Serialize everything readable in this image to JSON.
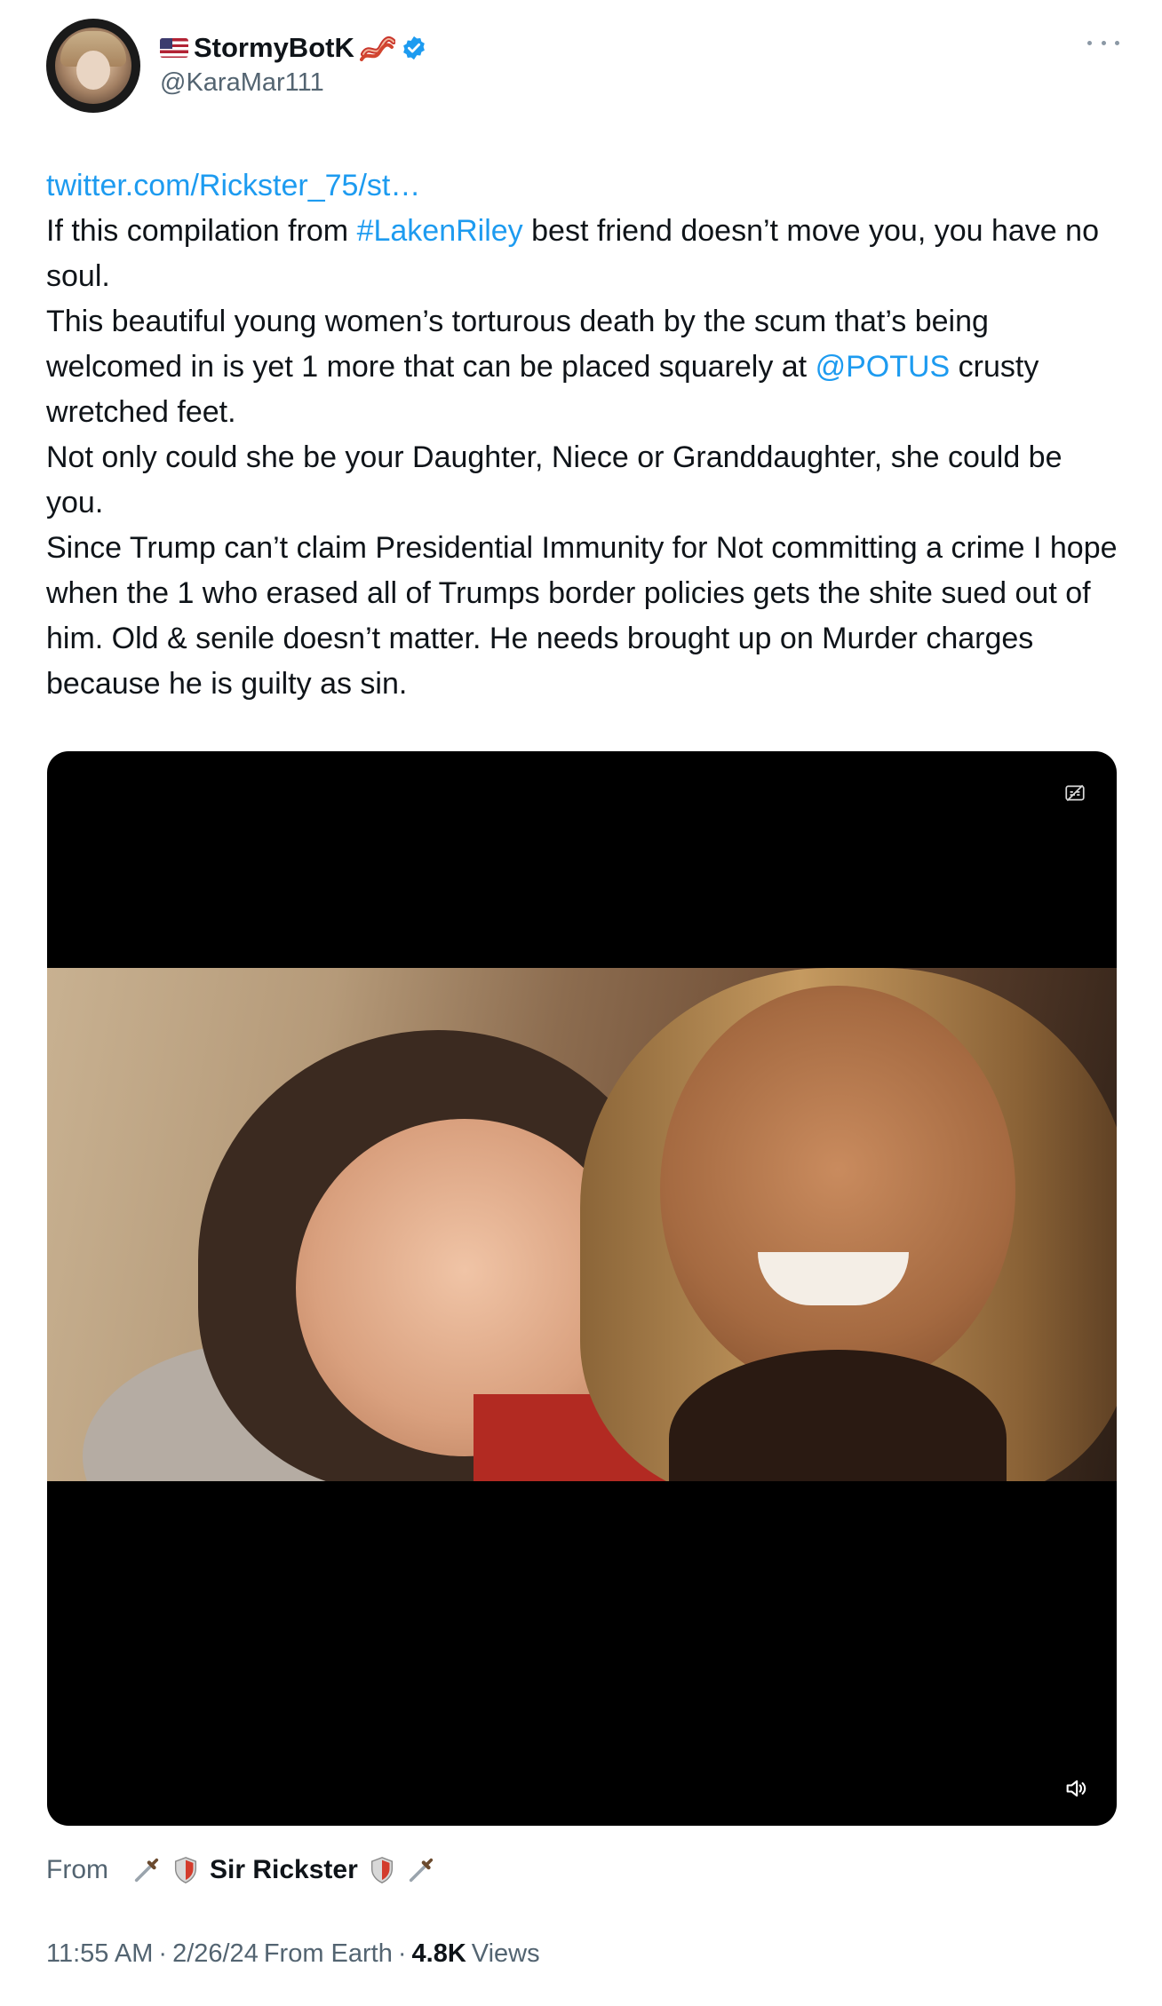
{
  "header": {
    "display_name": "StormyBotK",
    "handle": "@KaraMar111",
    "flag_icon": "us-flag-icon",
    "bacon_icon": "bacon-icon",
    "verified_icon": "verified-badge-icon",
    "verified_color": "#1d9bf0"
  },
  "tweet": {
    "link_text": "twitter.com/Rickster_75/st…",
    "line1_pre": "If this compilation from ",
    "hashtag": "#LakenRiley",
    "line1_post": " best friend doesn’t move you, you have no soul.",
    "line2_pre": "This beautiful young women’s torturous death by the scum that’s being welcomed in is yet 1 more that can be placed squarely at ",
    "mention": "@POTUS",
    "line2_post": " crusty wretched feet.",
    "line3": "Not only could she be your Daughter, Niece or Granddaughter, she could be you.",
    "line4": "Since Trump can’t claim Presidential Immunity for Not committing a crime I hope when the 1 who erased all of Trumps border policies gets the shite sued out of him. Old & senile doesn’t matter. He needs brought up on Murder charges because he is guilty as sin.",
    "link_color": "#1d9bf0"
  },
  "media": {
    "caption_icon": "closed-captions-icon",
    "volume_icon": "volume-icon"
  },
  "from": {
    "label": "From",
    "name": "Sir Rickster",
    "emoji_dagger": "dagger-icon",
    "emoji_shield": "shield-icon"
  },
  "meta": {
    "time": "11:55 AM",
    "sep1": "·",
    "date": "2/26/24",
    "source": "From Earth",
    "sep2": "·",
    "views_count": "4.8K",
    "views_label": "Views"
  }
}
